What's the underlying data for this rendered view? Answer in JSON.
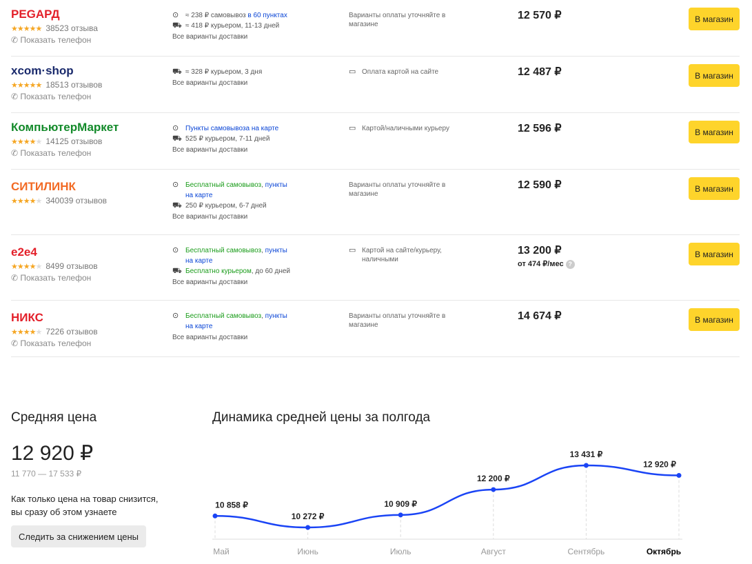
{
  "shops": [
    {
      "name": "РЕGАРД",
      "color": "#e3202a",
      "stars": 5,
      "reviews": "38523 отзыва",
      "phone": "Показать телефон",
      "delivery": [
        {
          "icon": "pin-icon",
          "parts": [
            [
              "≈ 238 ₽ самовывоз ",
              ""
            ],
            [
              "в 60 пунктах",
              "blue"
            ]
          ]
        },
        {
          "icon": "truck-icon",
          "parts": [
            [
              "≈ 418 ₽ курьером, 11-13 дней",
              ""
            ]
          ]
        }
      ],
      "all": "Все варианты доставки",
      "payment_icon": false,
      "payment": "Варианты оплаты уточняйте в магазине",
      "price": "12 570 ₽",
      "button": "В магазин"
    },
    {
      "name": "xcom·shop",
      "color": "#1a2a6c",
      "stars": 5,
      "reviews": "18513 отзывов",
      "phone": "Показать телефон",
      "delivery": [
        {
          "icon": "truck-icon",
          "parts": [
            [
              "≈ 328 ₽ курьером, 3 дня",
              ""
            ]
          ]
        }
      ],
      "all": "Все варианты доставки",
      "payment_icon": true,
      "payment": "Оплата картой на сайте",
      "price": "12 487 ₽",
      "button": "В магазин"
    },
    {
      "name": "КомпьютерМаркет",
      "color": "#138a2a",
      "stars": 4,
      "reviews": "14125 отзывов",
      "phone": "Показать телефон",
      "delivery": [
        {
          "icon": "pin-icon",
          "parts": [
            [
              "Пункты самовывоза на карте",
              "blue"
            ]
          ]
        },
        {
          "icon": "truck-icon",
          "parts": [
            [
              "525 ₽ курьером, 7-11 дней",
              ""
            ]
          ]
        }
      ],
      "all": "Все варианты доставки",
      "payment_icon": true,
      "payment": "Картой/наличными курьеру",
      "price": "12 596 ₽",
      "button": "В магазин"
    },
    {
      "name": "СИТИЛИНК",
      "color": "#f26a24",
      "stars": 4,
      "reviews": "340039 отзывов",
      "phone": null,
      "delivery": [
        {
          "icon": "pin-icon",
          "parts": [
            [
              "Бесплатный самовывоз",
              "green"
            ],
            [
              ", ",
              ""
            ],
            [
              "пункты на карте",
              "blue"
            ]
          ]
        },
        {
          "icon": "truck-icon",
          "parts": [
            [
              "250 ₽ курьером, 6-7 дней",
              ""
            ]
          ]
        }
      ],
      "all": "Все варианты доставки",
      "payment_icon": false,
      "payment": "Варианты оплаты уточняйте в магазине",
      "price": "12 590 ₽",
      "button": "В магазин"
    },
    {
      "name": "e2e4",
      "color": "#e3202a",
      "stars": 4,
      "reviews": "8499 отзывов",
      "phone": "Показать телефон",
      "delivery": [
        {
          "icon": "pin-icon",
          "parts": [
            [
              "Бесплатный самовывоз",
              "green"
            ],
            [
              ", ",
              ""
            ],
            [
              "пункты на карте",
              "blue"
            ]
          ]
        },
        {
          "icon": "truck-icon",
          "parts": [
            [
              "Бесплатно курьером",
              "green"
            ],
            [
              ", до 60 дней",
              ""
            ]
          ]
        }
      ],
      "all": "Все варианты доставки",
      "payment_icon": true,
      "payment": "Картой на сайте/курьеру, наличными",
      "price": "13 200 ₽",
      "installment": "от 474 ₽/мес",
      "button": "В магазин"
    },
    {
      "name": "НИКС",
      "color": "#e3202a",
      "stars": 4,
      "reviews": "7226 отзывов",
      "phone": "Показать телефон",
      "delivery": [
        {
          "icon": "pin-icon",
          "parts": [
            [
              "Бесплатный самовывоз",
              "green"
            ],
            [
              ", ",
              ""
            ],
            [
              "пункты на карте",
              "blue"
            ]
          ]
        }
      ],
      "all": "Все варианты доставки",
      "payment_icon": false,
      "payment": "Варианты оплаты уточняйте в магазине",
      "price": "14 674 ₽",
      "button": "В магазин"
    }
  ],
  "avg": {
    "title": "Средняя цена",
    "price": "12 920 ₽",
    "range": "11 770 — 17 533 ₽",
    "note": "Как только цена на товар снизится, вы сразу об этом узнаете",
    "button": "Следить за снижением цены"
  },
  "chart_data": {
    "type": "line",
    "title": "Динамика средней цены за полгода",
    "categories": [
      "Май",
      "Июнь",
      "Июль",
      "Август",
      "Сентябрь",
      "Октябрь"
    ],
    "values": [
      10858,
      10272,
      10909,
      12200,
      13431,
      12920
    ],
    "labels": [
      "10 858 ₽",
      "10 272 ₽",
      "10 909 ₽",
      "12 200 ₽",
      "13 431 ₽",
      "12 920 ₽"
    ],
    "current": "Октябрь",
    "color": "#1a44f5"
  }
}
